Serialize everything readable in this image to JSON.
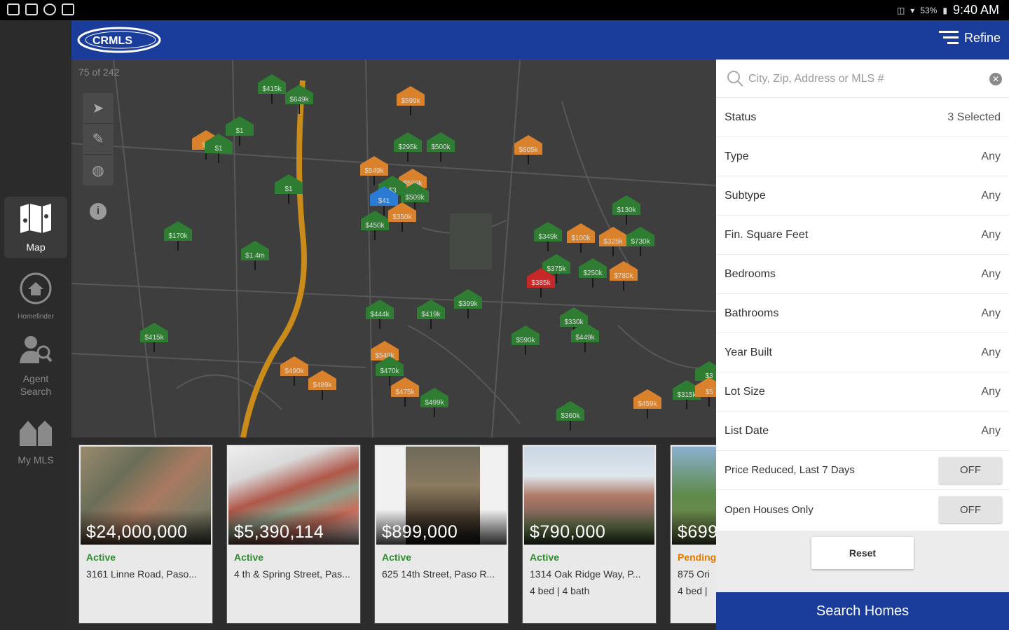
{
  "status_bar": {
    "time": "9:40 AM",
    "battery": "53%"
  },
  "brand": {
    "logo_text": "CRMLS"
  },
  "header": {
    "refine_label": "Refine"
  },
  "nav": {
    "items": [
      {
        "label": "Map",
        "icon": "map-icon"
      },
      {
        "label": "Homefinder",
        "icon": "home-circle-icon"
      },
      {
        "label": "Agent Search",
        "icon": "agent-search-icon"
      },
      {
        "label": "My MLS",
        "icon": "my-mls-icon"
      }
    ]
  },
  "map": {
    "count": "75 of 242",
    "pins": [
      {
        "label": "$415k",
        "color": "green"
      },
      {
        "label": "$599k",
        "color": "orange"
      },
      {
        "label": "$649k",
        "color": "green"
      },
      {
        "label": "$1",
        "color": "green"
      },
      {
        "label": "$1",
        "color": "orange"
      },
      {
        "label": "$1",
        "color": "green"
      },
      {
        "label": "$295k",
        "color": "green"
      },
      {
        "label": "$500k",
        "color": "green"
      },
      {
        "label": "$605k",
        "color": "orange"
      },
      {
        "label": "$549k",
        "color": "orange"
      },
      {
        "label": "$599k",
        "color": "orange"
      },
      {
        "label": "$3",
        "color": "green"
      },
      {
        "label": "$1",
        "color": "green"
      },
      {
        "label": "$509k",
        "color": "green"
      },
      {
        "label": "$41",
        "color": "blue"
      },
      {
        "label": "$450k",
        "color": "green"
      },
      {
        "label": "$350k",
        "color": "orange"
      },
      {
        "label": "$170k",
        "color": "green"
      },
      {
        "label": "$1.4m",
        "color": "green"
      },
      {
        "label": "$349k",
        "color": "green"
      },
      {
        "label": "$130k",
        "color": "green"
      },
      {
        "label": "$100k",
        "color": "orange"
      },
      {
        "label": "$325k",
        "color": "orange"
      },
      {
        "label": "$730k",
        "color": "green"
      },
      {
        "label": "$375k",
        "color": "green"
      },
      {
        "label": "$385k",
        "color": "red"
      },
      {
        "label": "$250k",
        "color": "green"
      },
      {
        "label": "$780k",
        "color": "orange"
      },
      {
        "label": "$444k",
        "color": "green"
      },
      {
        "label": "$419k",
        "color": "green"
      },
      {
        "label": "$399k",
        "color": "green"
      },
      {
        "label": "$330k",
        "color": "green"
      },
      {
        "label": "$449k",
        "color": "green"
      },
      {
        "label": "$590k",
        "color": "green"
      },
      {
        "label": "$415k",
        "color": "green"
      },
      {
        "label": "$490k",
        "color": "orange"
      },
      {
        "label": "$489k",
        "color": "orange"
      },
      {
        "label": "$549k",
        "color": "orange"
      },
      {
        "label": "$470k",
        "color": "green"
      },
      {
        "label": "$475k",
        "color": "orange"
      },
      {
        "label": "$499k",
        "color": "green"
      },
      {
        "label": "$360k",
        "color": "green"
      },
      {
        "label": "$459k",
        "color": "orange"
      },
      {
        "label": "$315k",
        "color": "green"
      },
      {
        "label": "$3",
        "color": "green"
      },
      {
        "label": "$5",
        "color": "orange"
      }
    ]
  },
  "listings": [
    {
      "price": "$24,000,000",
      "status": "Active",
      "address": "3161 Linne Road, Paso...",
      "beds": "",
      "status_color": "#2e8b2e"
    },
    {
      "price": "$5,390,114",
      "status": "Active",
      "address": "4 th & Spring Street, Pas...",
      "beds": "",
      "status_color": "#2e8b2e"
    },
    {
      "price": "$899,000",
      "status": "Active",
      "address": "625 14th Street, Paso R...",
      "beds": "",
      "status_color": "#2e8b2e"
    },
    {
      "price": "$790,000",
      "status": "Active",
      "address": "1314 Oak Ridge Way, P...",
      "beds": "4 bed | 4 bath",
      "status_color": "#2e8b2e"
    },
    {
      "price": "$699",
      "status": "Pending",
      "address": "875 Ori",
      "beds": "4 bed | ",
      "status_color": "#e07b00"
    }
  ],
  "refine": {
    "search": {
      "placeholder": "City, Zip, Address or MLS #",
      "value": ""
    },
    "filters": [
      {
        "label": "Status",
        "value": "3 Selected"
      },
      {
        "label": "Type",
        "value": "Any"
      },
      {
        "label": "Subtype",
        "value": "Any"
      },
      {
        "label": "Fin. Square Feet",
        "value": "Any"
      },
      {
        "label": "Bedrooms",
        "value": "Any"
      },
      {
        "label": "Bathrooms",
        "value": "Any"
      },
      {
        "label": "Year Built",
        "value": "Any"
      },
      {
        "label": "Lot Size",
        "value": "Any"
      },
      {
        "label": "List Date",
        "value": "Any"
      }
    ],
    "toggles": [
      {
        "label": "Price Reduced, Last 7 Days",
        "value": "OFF"
      },
      {
        "label": "Open Houses Only",
        "value": "OFF"
      }
    ],
    "reset_label": "Reset",
    "search_button_label": "Search Homes"
  },
  "colors": {
    "brand_blue": "#1a3d9c",
    "pin_green": "#2e7d32",
    "pin_orange": "#d9822b",
    "pin_blue": "#2a7bd4",
    "pin_red": "#c62828"
  }
}
